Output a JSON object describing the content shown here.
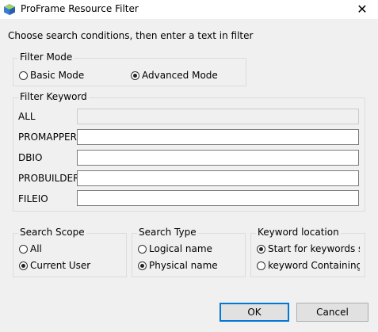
{
  "window": {
    "title": "ProFrame Resource Filter"
  },
  "instruction": "Choose search conditions, then enter a text in filter",
  "filter_mode": {
    "legend": "Filter Mode",
    "options": [
      {
        "label": "Basic Mode",
        "selected": false
      },
      {
        "label": "Advanced Mode",
        "selected": true
      }
    ]
  },
  "filter_keyword": {
    "legend": "Filter Keyword",
    "rows": [
      {
        "label": "ALL",
        "value": "",
        "enabled": false
      },
      {
        "label": "PROMAPPER",
        "value": "",
        "enabled": true
      },
      {
        "label": "DBIO",
        "value": "",
        "enabled": true
      },
      {
        "label": "PROBUILDER",
        "value": "",
        "enabled": true
      },
      {
        "label": "FILEIO",
        "value": "",
        "enabled": true
      }
    ]
  },
  "search_scope": {
    "legend": "Search Scope",
    "options": [
      {
        "label": "All",
        "selected": false
      },
      {
        "label": "Current User",
        "selected": true
      }
    ]
  },
  "search_type": {
    "legend": "Search Type",
    "options": [
      {
        "label": "Logical name",
        "selected": false
      },
      {
        "label": "Physical name",
        "selected": true
      }
    ]
  },
  "keyword_location": {
    "legend": "Keyword location",
    "options": [
      {
        "label": "Start for keywords sta",
        "selected": true
      },
      {
        "label": "keyword Containing",
        "selected": false
      }
    ]
  },
  "buttons": {
    "ok": "OK",
    "cancel": "Cancel"
  }
}
